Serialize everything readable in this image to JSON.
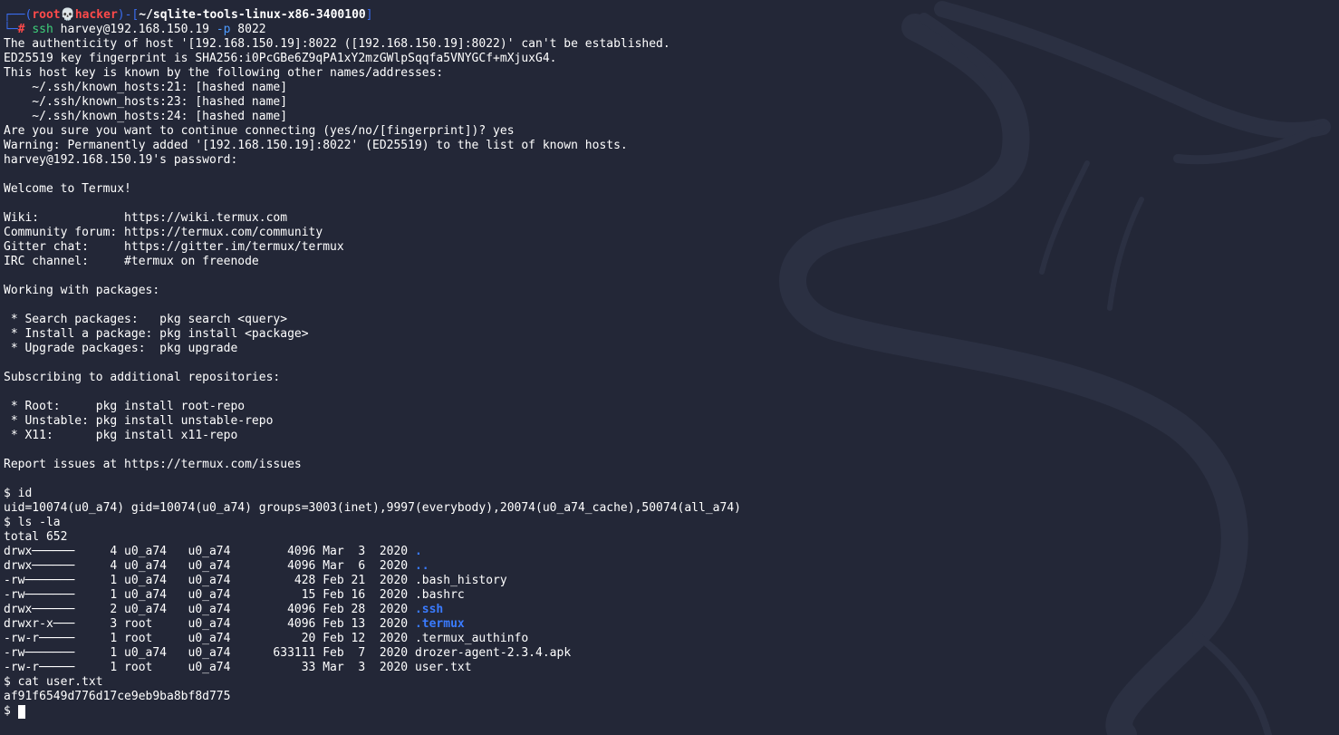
{
  "prompt": {
    "frame_top": "┌──(",
    "user": "root",
    "skull": "💀",
    "host": "hacker",
    "mid": ")-[",
    "dir": "~/sqlite-tools-linux-x86-3400100",
    "end": "]",
    "frame_bottom": "└─",
    "hash": "#"
  },
  "command": {
    "program": "ssh",
    "args": " harvey@192.168.150.19 ",
    "option": "-p",
    "port": " 8022"
  },
  "output_lines": [
    "The authenticity of host '[192.168.150.19]:8022 ([192.168.150.19]:8022)' can't be established.",
    "ED25519 key fingerprint is SHA256:i0PcGBe6Z9qPA1xY2mzGWlpSqqfa5VNYGCf+mXjuxG4.",
    "This host key is known by the following other names/addresses:",
    "    ~/.ssh/known_hosts:21: [hashed name]",
    "    ~/.ssh/known_hosts:23: [hashed name]",
    "    ~/.ssh/known_hosts:24: [hashed name]",
    "Are you sure you want to continue connecting (yes/no/[fingerprint])? yes",
    "Warning: Permanently added '[192.168.150.19]:8022' (ED25519) to the list of known hosts.",
    "harvey@192.168.150.19's password: ",
    "",
    "Welcome to Termux!",
    "",
    "Wiki:            https://wiki.termux.com",
    "Community forum: https://termux.com/community",
    "Gitter chat:     https://gitter.im/termux/termux",
    "IRC channel:     #termux on freenode",
    "",
    "Working with packages:",
    "",
    " * Search packages:   pkg search <query>",
    " * Install a package: pkg install <package>",
    " * Upgrade packages:  pkg upgrade",
    "",
    "Subscribing to additional repositories:",
    "",
    " * Root:     pkg install root-repo",
    " * Unstable: pkg install unstable-repo",
    " * X11:      pkg install x11-repo",
    "",
    "Report issues at https://termux.com/issues",
    "",
    "$ id",
    "uid=10074(u0_a74) gid=10074(u0_a74) groups=3003(inet),9997(everybody),20074(u0_a74_cache),50074(all_a74)",
    "$ ls -la",
    "total 652"
  ],
  "listing": [
    {
      "meta": "drwx──────     4 u0_a74   u0_a74        4096 Mar  3  2020 ",
      "name": ".",
      "is_dir": true
    },
    {
      "meta": "drwx──────     4 u0_a74   u0_a74        4096 Mar  6  2020 ",
      "name": "..",
      "is_dir": true
    },
    {
      "meta": "-rw───────     1 u0_a74   u0_a74         428 Feb 21  2020 ",
      "name": ".bash_history",
      "is_dir": false
    },
    {
      "meta": "-rw───────     1 u0_a74   u0_a74          15 Feb 16  2020 ",
      "name": ".bashrc",
      "is_dir": false
    },
    {
      "meta": "drwx──────     2 u0_a74   u0_a74        4096 Feb 28  2020 ",
      "name": ".ssh",
      "is_dir": true
    },
    {
      "meta": "drwxr-x───     3 root     u0_a74        4096 Feb 13  2020 ",
      "name": ".termux",
      "is_dir": true
    },
    {
      "meta": "-rw-r─────     1 root     u0_a74          20 Feb 12  2020 ",
      "name": ".termux_authinfo",
      "is_dir": false
    },
    {
      "meta": "-rw───────     1 u0_a74   u0_a74      633111 Feb  7  2020 ",
      "name": "drozer-agent-2.3.4.apk",
      "is_dir": false
    },
    {
      "meta": "-rw-r─────     1 root     u0_a74          33 Mar  3  2020 ",
      "name": "user.txt",
      "is_dir": false
    }
  ],
  "tail_lines": [
    "$ cat user.txt",
    "af91f6549d776d17ce9eb9ba8bf8d775"
  ],
  "input_prompt": "$ ",
  "colors": {
    "background": "#232737",
    "prompt_frame": "#3a6df0",
    "prompt_user": "#ff4a4a",
    "command": "#3ed07a",
    "directory": "#3a7bff",
    "text": "#ffffff"
  }
}
